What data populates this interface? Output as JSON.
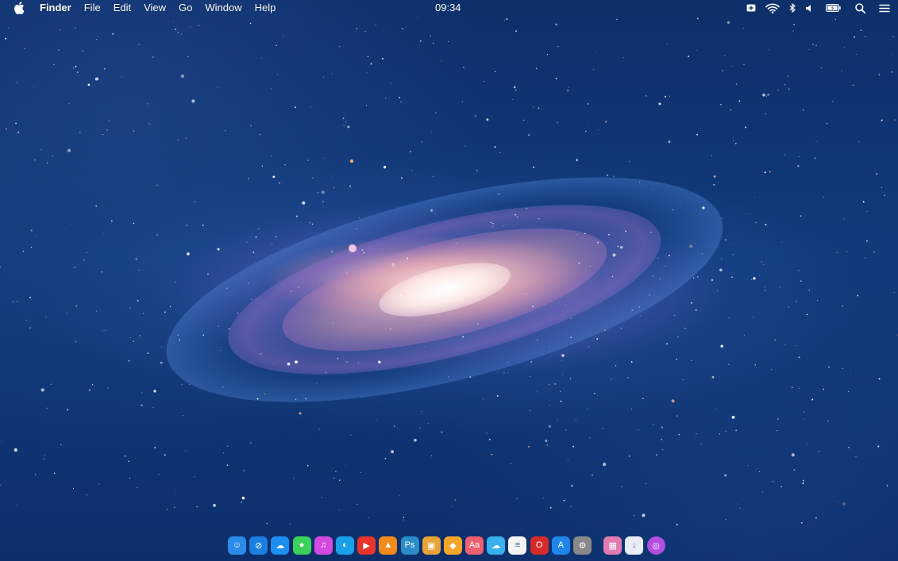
{
  "menubar": {
    "apple_icon": "apple-logo-icon",
    "app_name": "Finder",
    "menus": [
      "File",
      "Edit",
      "View",
      "Go",
      "Window",
      "Help"
    ],
    "clock": "09:34",
    "status_icons": [
      "battery-plus-icon",
      "wifi-icon",
      "bluetooth-icon",
      "volume-icon",
      "battery-icon",
      "spotlight-search-icon",
      "notification-center-icon"
    ]
  },
  "desktop": {
    "wallpaper": "Andromeda galaxy"
  },
  "dock": {
    "apps": [
      {
        "name": "finder-icon",
        "color": "#2b8be8"
      },
      {
        "name": "safari-icon",
        "color": "#1a7fe0"
      },
      {
        "name": "icloud-icon",
        "color": "#1d8ff0"
      },
      {
        "name": "messages-icon",
        "color": "#3bd15a"
      },
      {
        "name": "itunes-icon",
        "color": "#d44ae0"
      },
      {
        "name": "tweetbot-icon",
        "color": "#1aa0e8"
      },
      {
        "name": "youtube-icon",
        "color": "#e8332b"
      },
      {
        "name": "vlc-icon",
        "color": "#f08a1a"
      },
      {
        "name": "photoshop-icon",
        "color": "#2a8cc8"
      },
      {
        "name": "preview-icon",
        "color": "#e8a33a"
      },
      {
        "name": "sketch-icon",
        "color": "#f5a52a"
      },
      {
        "name": "dictionary-icon",
        "color": "#ee5f6f"
      },
      {
        "name": "weather-icon",
        "color": "#3ab0ee"
      },
      {
        "name": "reminders-icon",
        "color": "#f4f4f4"
      },
      {
        "name": "opera-icon",
        "color": "#d42a2a"
      },
      {
        "name": "app-store-icon",
        "color": "#1f86e8"
      },
      {
        "name": "system-preferences-icon",
        "color": "#888888"
      },
      {
        "name": "launchpad-icon",
        "color": "#e27bb0"
      },
      {
        "name": "downloads-icon",
        "color": "#e8edf5"
      },
      {
        "name": "siri-icon",
        "color": "#b14ee0"
      }
    ]
  }
}
